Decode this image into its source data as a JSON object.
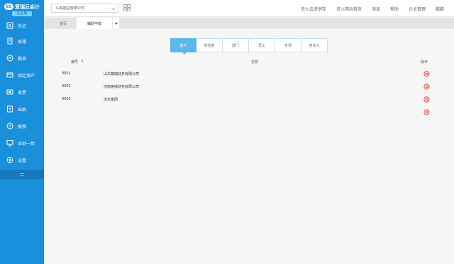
{
  "brand": {
    "mark": "ED",
    "name": "爱瑞云会计",
    "edition": "企业版"
  },
  "sidebar": {
    "items": [
      {
        "label": "凭证",
        "icon": "voucher-icon"
      },
      {
        "label": "账簿",
        "icon": "ledger-icon"
      },
      {
        "label": "报表",
        "icon": "report-icon"
      },
      {
        "label": "固定资产",
        "icon": "fixed-asset-icon"
      },
      {
        "label": "发票",
        "icon": "invoice-icon"
      },
      {
        "label": "出纳",
        "icon": "cashier-icon"
      },
      {
        "label": "报税",
        "icon": "tax-icon"
      },
      {
        "label": "业财一体",
        "icon": "business-finance-icon"
      },
      {
        "label": "设置",
        "icon": "settings-icon"
      }
    ]
  },
  "header": {
    "company": "山东欧冠有限公司",
    "links": [
      "进入云进销存",
      "进入网站首页",
      "消息",
      "帮助",
      "企业管理",
      "鹏鹏"
    ]
  },
  "tabs": {
    "home": "首页",
    "active": "辅助字典"
  },
  "subtabs": [
    "客户",
    "供应商",
    "部门",
    "员工",
    "专项",
    "自定义"
  ],
  "table": {
    "headers": {
      "code": "编号",
      "sort": "⇅",
      "name": "名称",
      "action": "操作"
    },
    "rows": [
      {
        "code": "0001",
        "name": "山东魏瑞财务有限公司"
      },
      {
        "code": "0002",
        "name": "济南施咏财务有限公司"
      },
      {
        "code": "0003",
        "name": "流水集团"
      },
      {
        "code": "",
        "name": ""
      }
    ]
  },
  "colors": {
    "sidebar": "#1a8fdc",
    "accent": "#5cb8ea",
    "delete": "#e0413a"
  }
}
